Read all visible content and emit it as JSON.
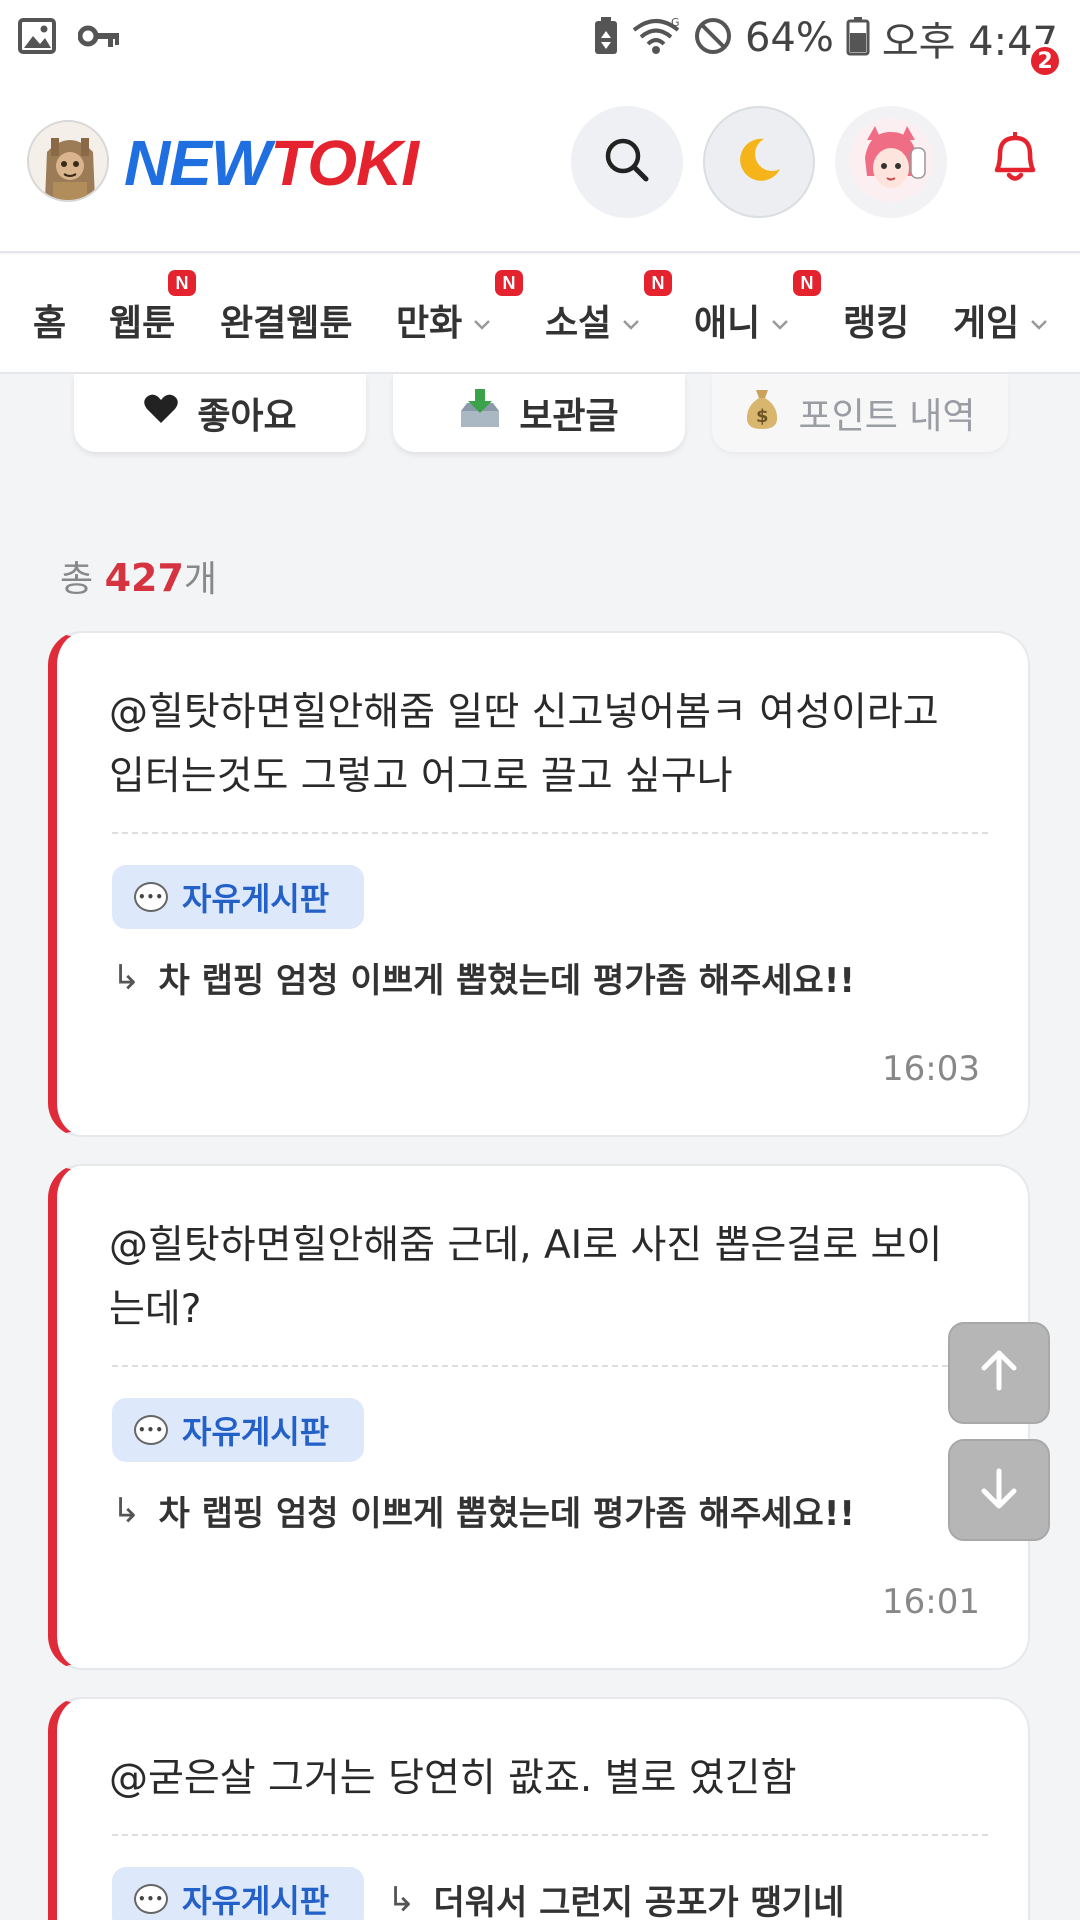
{
  "status_bar": {
    "battery": "64%",
    "time": "오후 4:47",
    "icons": [
      "image-icon",
      "key-icon",
      "battery-saver-icon",
      "wifi-icon",
      "dnd-icon",
      "battery-icon"
    ]
  },
  "header": {
    "logo_left": "NEW",
    "logo_right": "TOKI",
    "notification_count": "2",
    "colors": {
      "logo_blue": "#1f6fe0",
      "logo_red": "#e5232f"
    }
  },
  "nav": {
    "items": [
      {
        "label": "홈"
      },
      {
        "label": "웹툰",
        "badge": "N"
      },
      {
        "label": "완결웹툰"
      },
      {
        "label": "만화",
        "badge": "N"
      },
      {
        "label": "소설",
        "badge": "N"
      },
      {
        "label": "애니",
        "badge": "N"
      },
      {
        "label": "랭킹"
      },
      {
        "label": "게임"
      }
    ]
  },
  "quick": {
    "likes": "좋아요",
    "saved": "보관글",
    "points": "포인트 내역"
  },
  "total": {
    "prefix": "총",
    "count": "427",
    "suffix": "개"
  },
  "comments": [
    {
      "text": "@힐탓하면힐안해줌 일딴 신고넣어봄ㅋ 여성이라고 입터는것도 그렇고 어그로 끌고 싶구나",
      "board": "자유게시판",
      "post_title": "차 랩핑 엄청 이쁘게 뽑혔는데 평가좀 해주세요!!",
      "time": "16:03"
    },
    {
      "text": "@힐탓하면힐안해줌 근데, AI로 사진 뽑은걸로 보이는데?",
      "board": "자유게시판",
      "post_title": "차 랩핑 엄청 이쁘게 뽑혔는데 평가좀 해주세요!!",
      "time": "16:01"
    },
    {
      "text": "@굳은살 그거는 당연히 괎죠. 별로 였긴함",
      "board": "자유게시판",
      "post_title": "더워서 그런지 공포가 땡기네"
    }
  ],
  "arrow_glyph": "↳",
  "accent_color": "#e02b39"
}
